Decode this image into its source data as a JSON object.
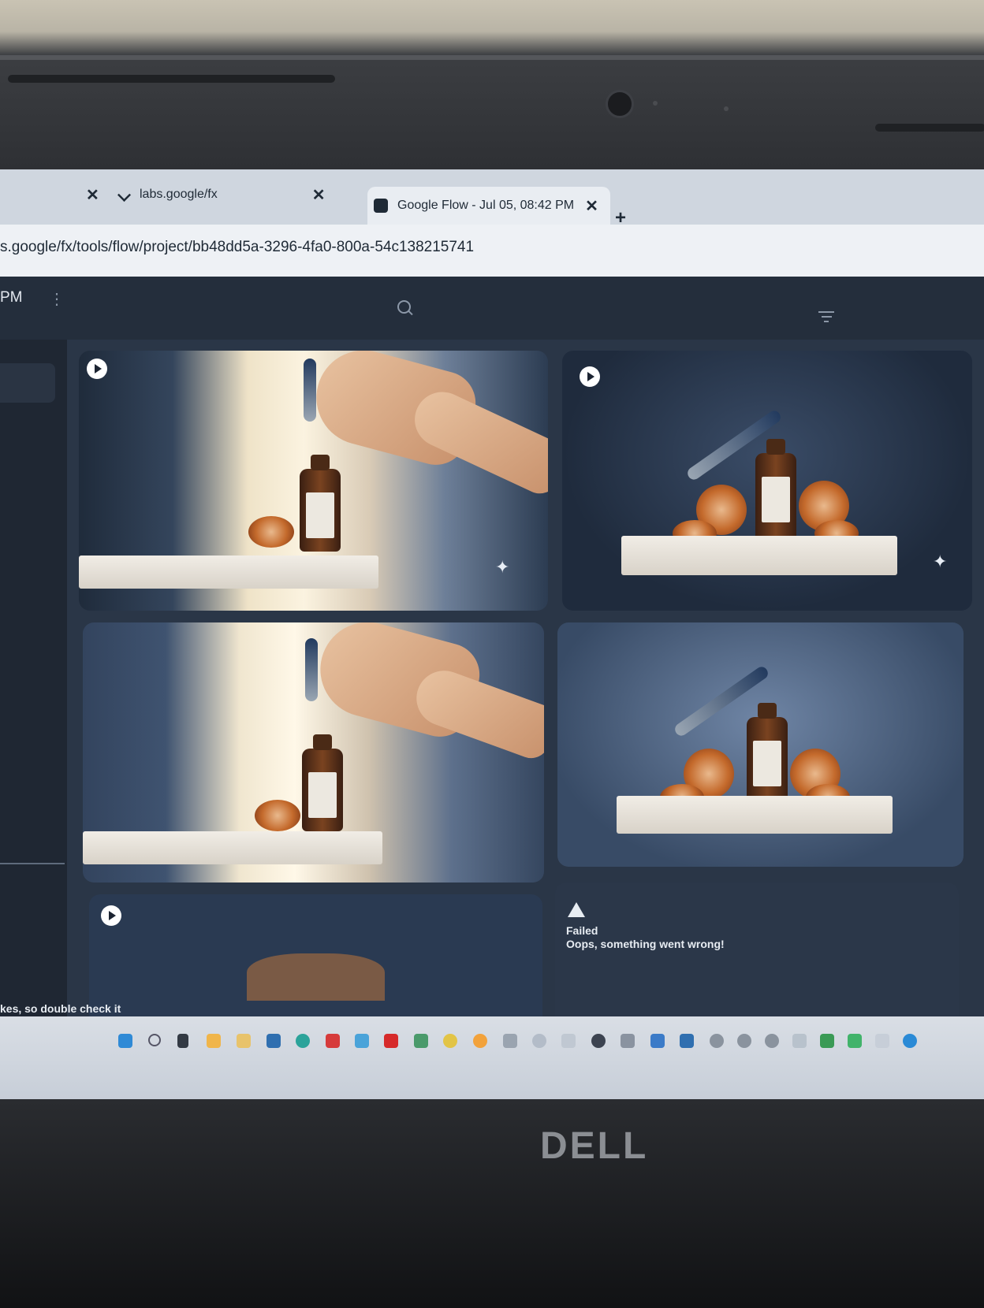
{
  "browser": {
    "tabs": [
      {
        "label": ""
      },
      {
        "label": "labs.google/fx"
      },
      {
        "label": "Google Flow - Jul 05, 08:42 PM"
      }
    ],
    "url": "s.google/fx/tools/flow/project/bb48dd5a-3296-4fa0-800a-54c138215741"
  },
  "app": {
    "time_fragment": "PM",
    "failed_card": {
      "title": "Failed",
      "message": "Oops, something went wrong!"
    },
    "disclaimer": "kes, so double check it"
  },
  "laptop": {
    "brand": "DELL"
  }
}
